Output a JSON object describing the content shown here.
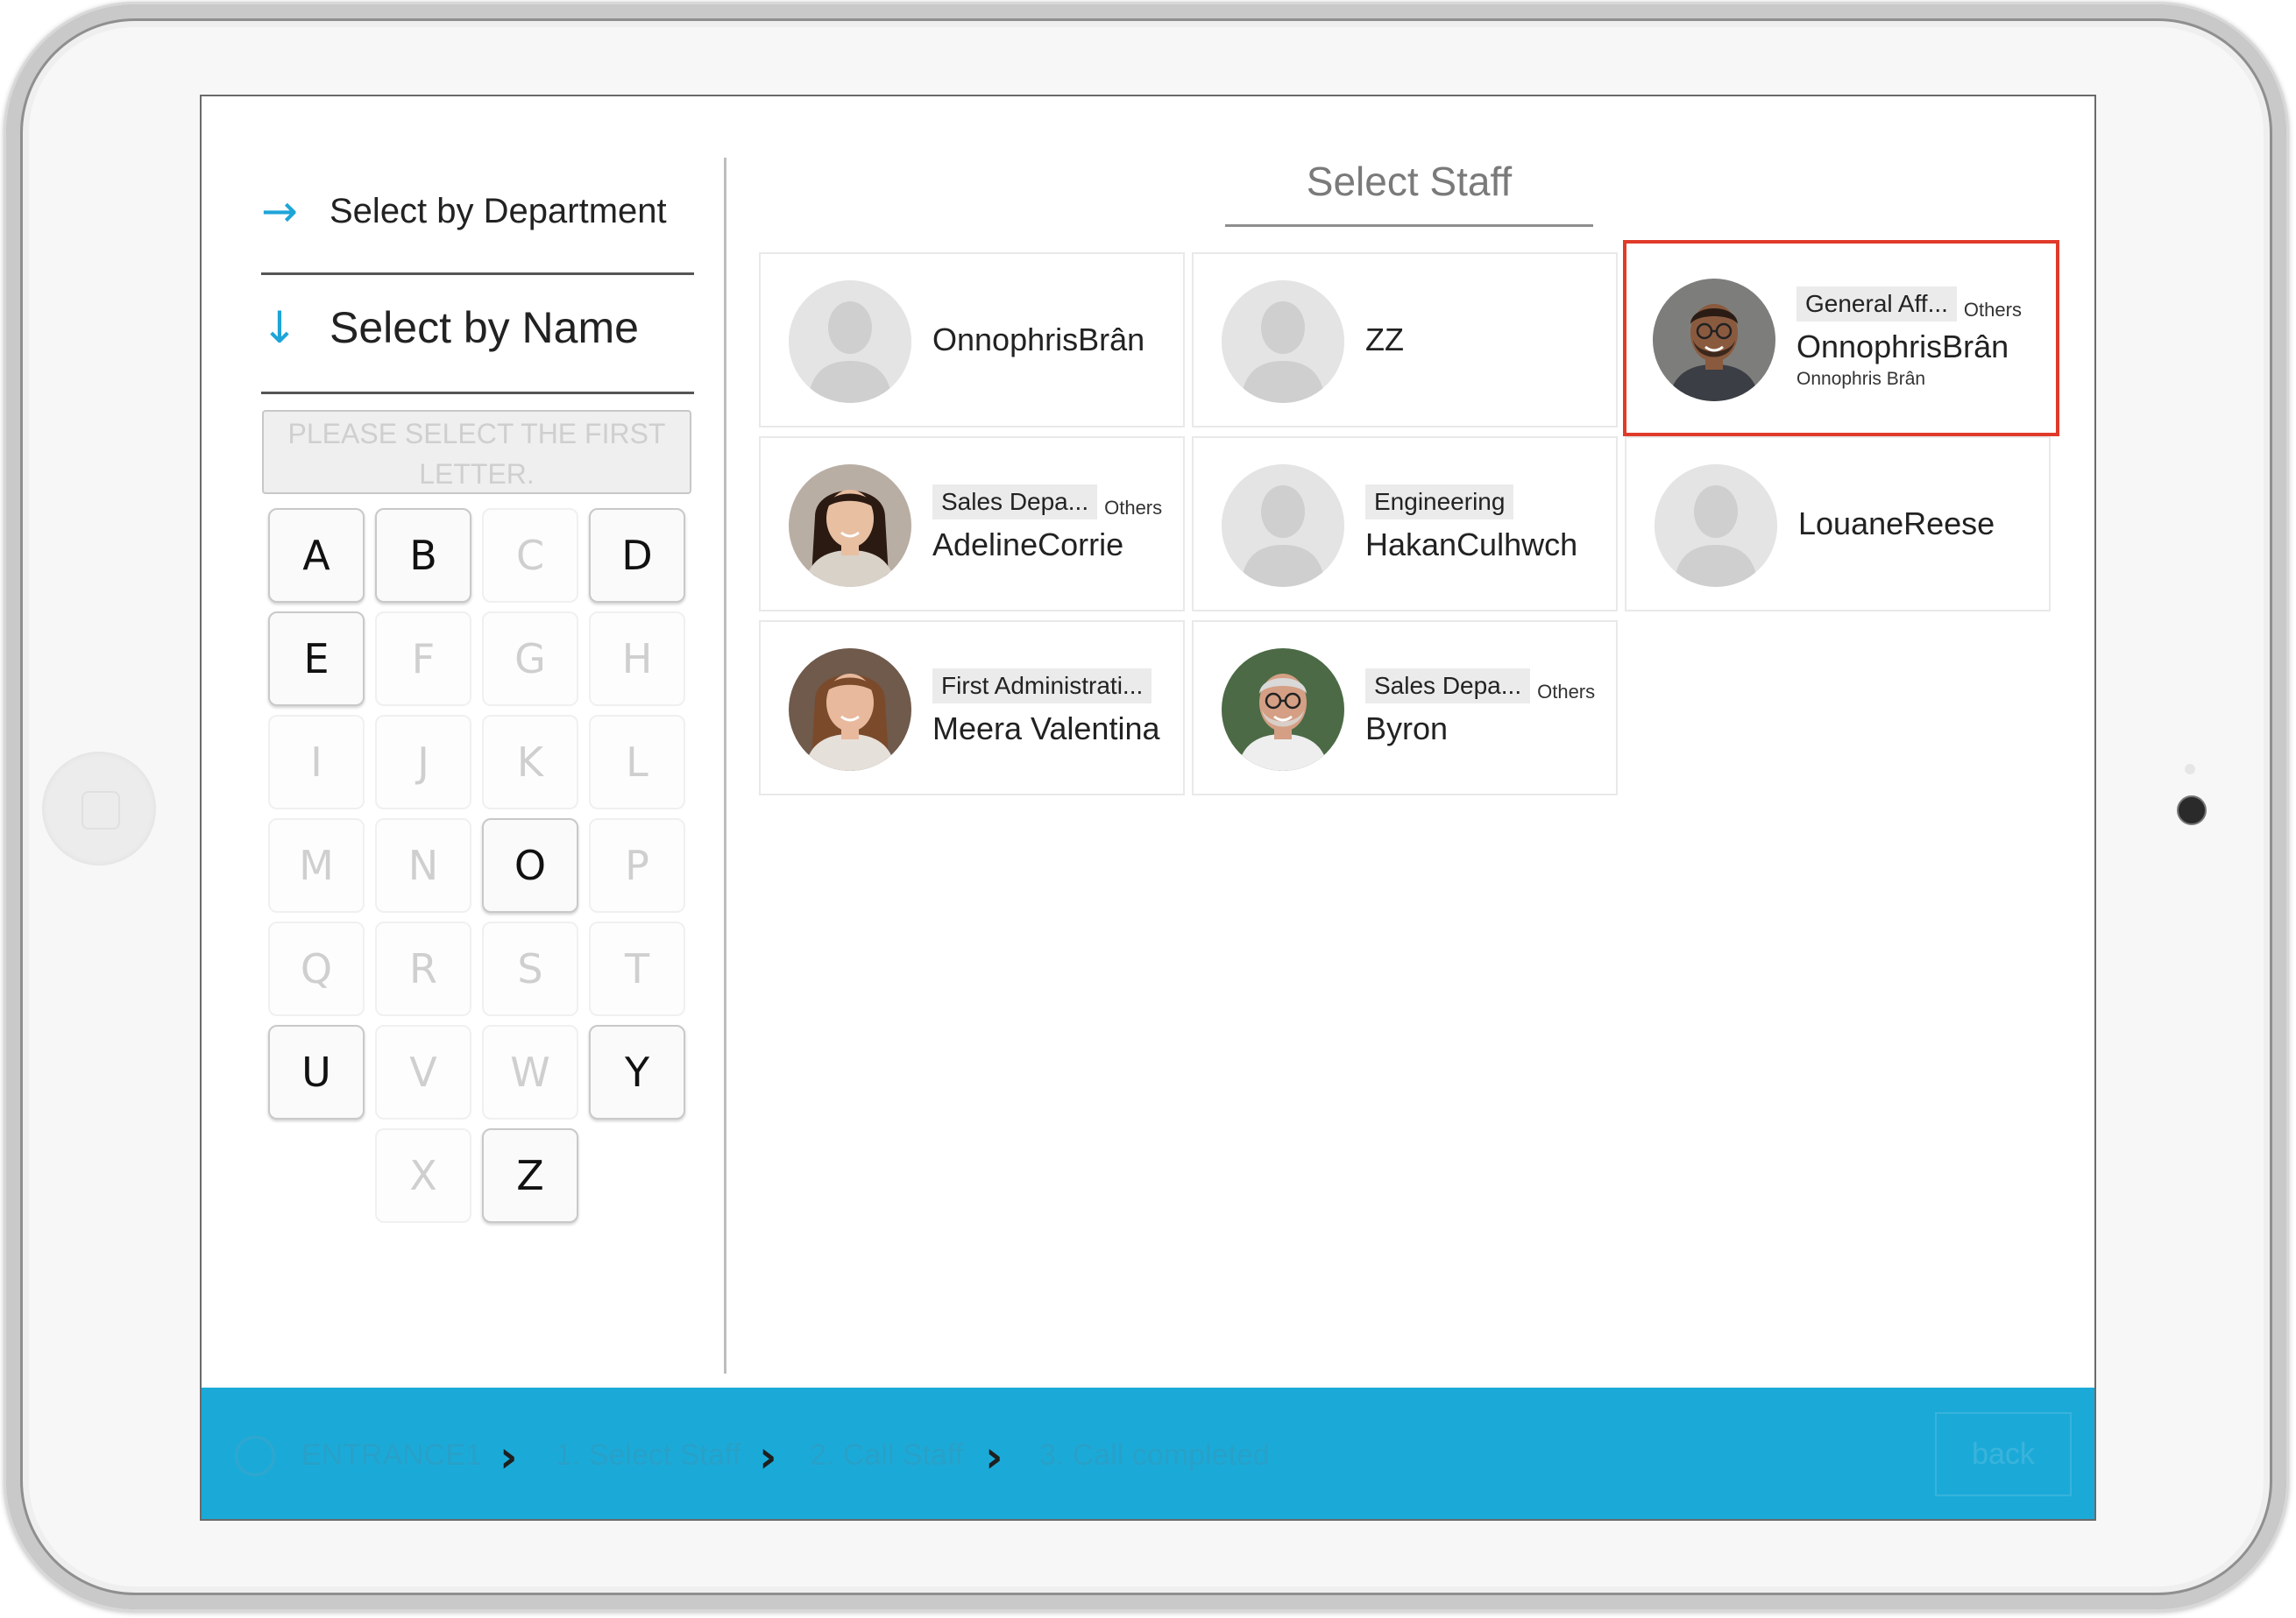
{
  "left_panel": {
    "nav_department": "Select by Department",
    "nav_name": "Select by Name",
    "hint": "PLEASE SELECT THE FIRST LETTER.",
    "letters": [
      {
        "char": "A",
        "enabled": true
      },
      {
        "char": "B",
        "enabled": true
      },
      {
        "char": "C",
        "enabled": false
      },
      {
        "char": "D",
        "enabled": true
      },
      {
        "char": "E",
        "enabled": true
      },
      {
        "char": "F",
        "enabled": false
      },
      {
        "char": "G",
        "enabled": false
      },
      {
        "char": "H",
        "enabled": false
      },
      {
        "char": "I",
        "enabled": false
      },
      {
        "char": "J",
        "enabled": false
      },
      {
        "char": "K",
        "enabled": false
      },
      {
        "char": "L",
        "enabled": false
      },
      {
        "char": "M",
        "enabled": false
      },
      {
        "char": "N",
        "enabled": false
      },
      {
        "char": "O",
        "enabled": true
      },
      {
        "char": "P",
        "enabled": false
      },
      {
        "char": "Q",
        "enabled": false
      },
      {
        "char": "R",
        "enabled": false
      },
      {
        "char": "S",
        "enabled": false
      },
      {
        "char": "T",
        "enabled": false
      },
      {
        "char": "U",
        "enabled": true
      },
      {
        "char": "V",
        "enabled": false
      },
      {
        "char": "W",
        "enabled": false
      },
      {
        "char": "Y",
        "enabled": true
      },
      {
        "char": "X",
        "enabled": false
      },
      {
        "char": "Z",
        "enabled": true
      }
    ]
  },
  "main": {
    "title": "Select Staff",
    "cards": [
      {
        "name": "OnnophrisBrân",
        "department": "",
        "other": "",
        "subname": "",
        "photo": "placeholder",
        "selected": false
      },
      {
        "name": "ZZ",
        "department": "",
        "other": "",
        "subname": "",
        "photo": "placeholder",
        "selected": false
      },
      {
        "name": "OnnophrisBrân",
        "department": "General Aff...",
        "other": "Others",
        "subname": "Onnophris Brân",
        "photo": "man-glasses",
        "selected": true
      },
      {
        "name": "AdelineCorrie",
        "department": "Sales Depa...",
        "other": "Others",
        "subname": "",
        "photo": "woman-dark-hair",
        "selected": false
      },
      {
        "name": "HakanCulhwch",
        "department": "Engineering",
        "other": "",
        "subname": "",
        "photo": "placeholder",
        "selected": false
      },
      {
        "name": "LouaneReese",
        "department": "",
        "other": "",
        "subname": "",
        "photo": "placeholder",
        "selected": false
      },
      {
        "name": "Meera Valentina",
        "department": "First Administrati...",
        "other": "",
        "subname": "",
        "photo": "woman-light-hair",
        "selected": false
      },
      {
        "name": "Byron",
        "department": "Sales Depa...",
        "other": "Others",
        "subname": "",
        "photo": "older-man",
        "selected": false
      }
    ]
  },
  "footer": {
    "entrance": "ENTRANCE1",
    "step1": "1. Select Staff",
    "step2": "2. Call Staff",
    "step3": "3. Call completed",
    "back": "back"
  },
  "colors": {
    "accent": "#1baad8",
    "selection": "#e03a2a",
    "arrow": "#1ea5d8"
  }
}
